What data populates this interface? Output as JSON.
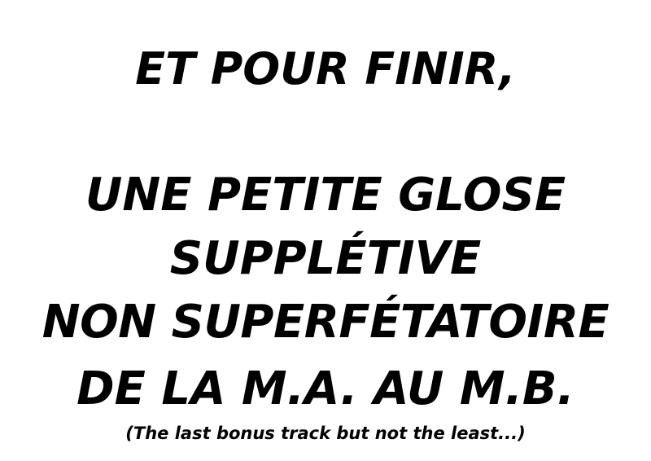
{
  "slide": {
    "heading": "ET POUR FINIR,",
    "title_lines": [
      "UNE PETITE GLOSE",
      "SUPPLÉTIVE",
      "NON SUPERFÉTATOIRE",
      "DE LA M.A. AU M.B."
    ],
    "subtitle": "(The last bonus track but not the least...)"
  }
}
